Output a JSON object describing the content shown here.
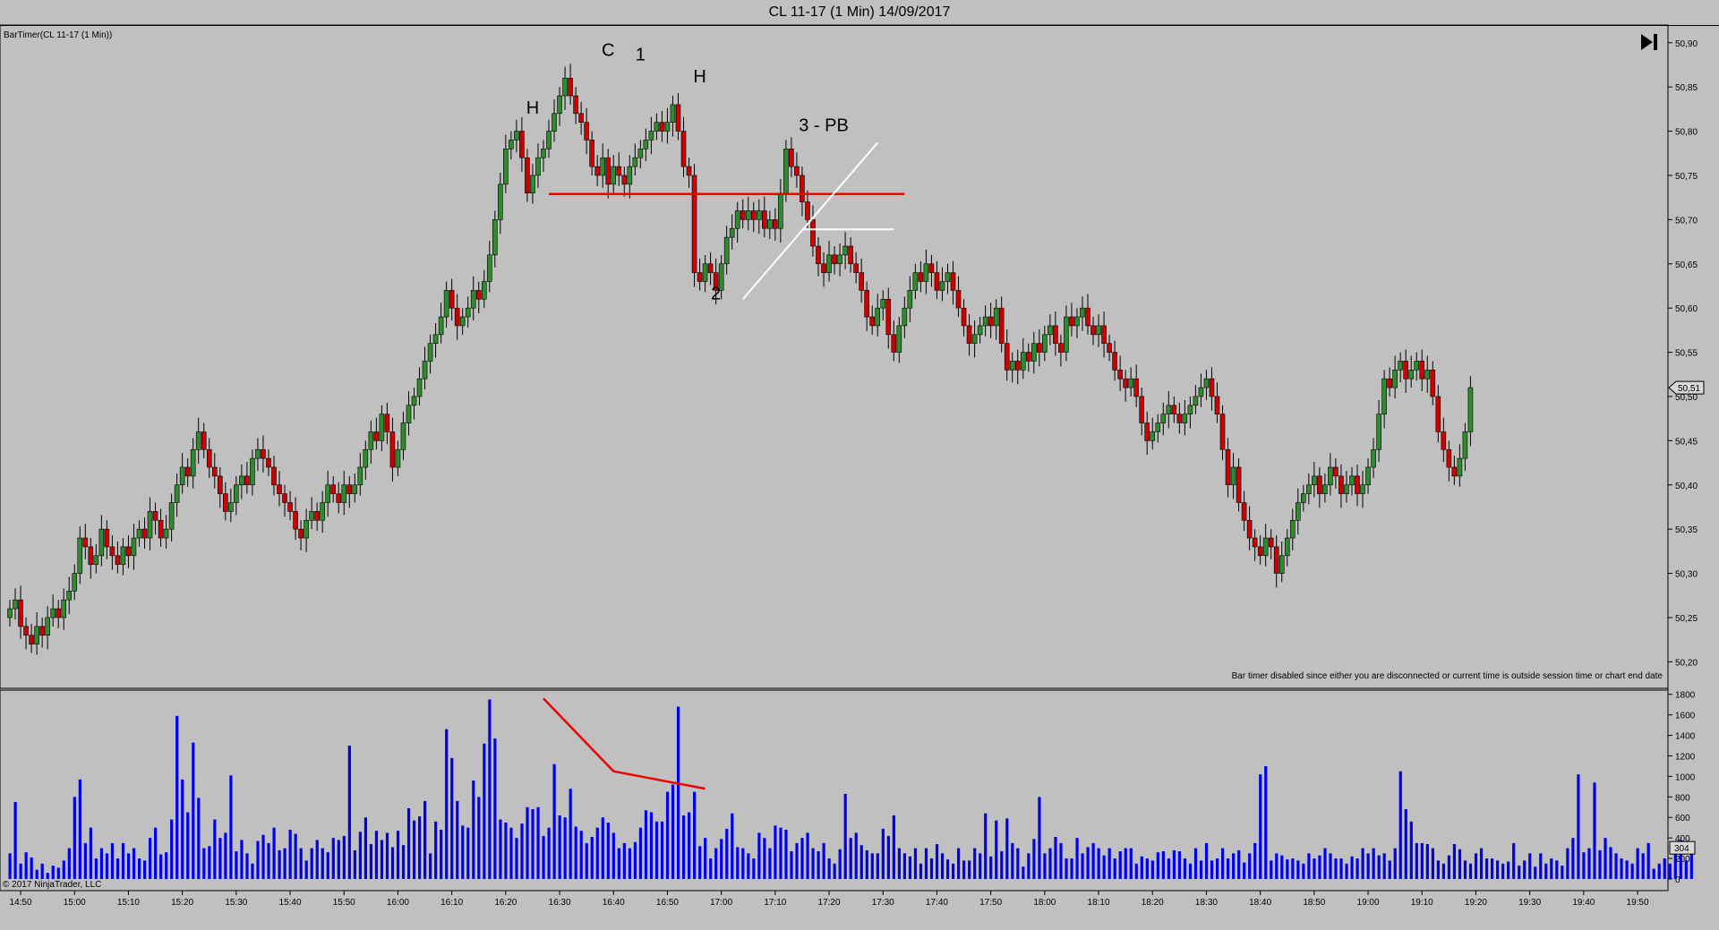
{
  "window": {
    "title": "CL 11-17 (1 Min)  14/09/2017"
  },
  "indicator_label": "BarTimer(CL 11-17 (1 Min))",
  "status_message": "Bar timer disabled since either you are disconnected or current time is outside session time or chart end date",
  "copyright": "© 2017 NinjaTrader, LLC",
  "colors": {
    "background": "#c0c0c0",
    "up_candle": "#2e8b2e",
    "down_candle": "#cc0000",
    "volume": "#0000ee",
    "red_annotation": "#ee0000",
    "white_line": "#ffffff"
  },
  "icons": {
    "go_to_end": "skip-to-end-icon"
  },
  "annotations": [
    {
      "text": "C",
      "time": "16:39",
      "price": 50.885
    },
    {
      "text": "1",
      "time": "16:45",
      "price": 50.88
    },
    {
      "text": "H",
      "time": "16:56",
      "price": 50.855
    },
    {
      "text": "H",
      "time": "16:25",
      "price": 50.82
    },
    {
      "text": "3 - PB",
      "time": "17:19",
      "price": 50.8
    },
    {
      "text": "2",
      "time": "16:59",
      "price": 50.61
    }
  ],
  "chart_data": [
    {
      "type": "candlestick",
      "instrument": "CL 11-17 (1 Min)",
      "date": "14/09/2017",
      "ylim": [
        50.17,
        50.92
      ],
      "y_ticks": [
        "50,90",
        "50,85",
        "50,80",
        "50,75",
        "50,70",
        "50,65",
        "50,60",
        "50,55",
        "50,50",
        "50,45",
        "50,40",
        "50,35",
        "50,30",
        "50,25",
        "50,20"
      ],
      "y_tick_values": [
        50.9,
        50.85,
        50.8,
        50.75,
        50.7,
        50.65,
        50.6,
        50.55,
        50.5,
        50.45,
        50.4,
        50.35,
        50.3,
        50.25,
        50.2
      ],
      "last_price_label": "50,51",
      "last_price": 50.51,
      "closes": [
        50.26,
        50.27,
        50.24,
        50.23,
        50.22,
        50.24,
        50.23,
        50.25,
        50.26,
        50.25,
        50.27,
        50.28,
        50.3,
        50.34,
        50.33,
        50.31,
        50.32,
        50.35,
        50.33,
        50.32,
        50.31,
        50.33,
        50.32,
        50.34,
        50.35,
        50.34,
        50.37,
        50.36,
        50.34,
        50.35,
        50.38,
        50.4,
        50.42,
        50.41,
        50.44,
        50.46,
        50.44,
        50.42,
        50.41,
        50.39,
        50.37,
        50.38,
        50.4,
        50.41,
        50.4,
        50.43,
        50.44,
        50.43,
        50.42,
        50.4,
        50.39,
        50.38,
        50.37,
        50.35,
        50.34,
        50.36,
        50.37,
        50.36,
        50.38,
        50.4,
        50.39,
        50.38,
        50.4,
        50.39,
        50.4,
        50.42,
        50.44,
        50.46,
        50.45,
        50.48,
        50.46,
        50.42,
        50.44,
        50.47,
        50.49,
        50.5,
        50.52,
        50.54,
        50.56,
        50.57,
        50.59,
        50.62,
        50.6,
        50.58,
        50.59,
        50.6,
        50.62,
        50.61,
        50.63,
        50.66,
        50.7,
        50.74,
        50.78,
        50.79,
        50.8,
        50.77,
        50.73,
        50.75,
        50.77,
        50.78,
        50.8,
        50.82,
        50.84,
        50.86,
        50.84,
        50.82,
        50.81,
        50.79,
        50.76,
        50.75,
        50.77,
        50.74,
        50.76,
        50.75,
        50.74,
        50.76,
        50.77,
        50.78,
        50.79,
        50.8,
        50.81,
        50.8,
        50.81,
        50.83,
        50.8,
        50.76,
        50.75,
        50.64,
        50.63,
        50.65,
        50.64,
        50.62,
        50.65,
        50.68,
        50.69,
        50.71,
        50.7,
        50.71,
        50.7,
        50.71,
        50.69,
        50.7,
        50.69,
        50.73,
        50.78,
        50.76,
        50.75,
        50.72,
        50.7,
        50.67,
        50.65,
        50.64,
        50.66,
        50.65,
        50.66,
        50.67,
        50.65,
        50.64,
        50.62,
        50.59,
        50.58,
        50.6,
        50.61,
        50.57,
        50.55,
        50.58,
        50.6,
        50.62,
        50.64,
        50.63,
        50.65,
        50.64,
        50.62,
        50.63,
        50.64,
        50.62,
        50.6,
        50.58,
        50.56,
        50.57,
        50.58,
        50.59,
        50.58,
        50.6,
        50.56,
        50.53,
        50.54,
        50.53,
        50.55,
        50.54,
        50.56,
        50.55,
        50.57,
        50.58,
        50.56,
        50.55,
        50.59,
        50.58,
        50.59,
        50.6,
        50.58,
        50.57,
        50.58,
        50.56,
        50.55,
        50.53,
        50.52,
        50.51,
        50.52,
        50.5,
        50.47,
        50.45,
        50.46,
        50.47,
        50.48,
        50.49,
        50.48,
        50.47,
        50.48,
        50.49,
        50.5,
        50.51,
        50.52,
        50.5,
        50.48,
        50.44,
        50.4,
        50.42,
        50.38,
        50.36,
        50.34,
        50.33,
        50.32,
        50.34,
        50.33,
        50.3,
        50.32,
        50.34,
        50.36,
        50.38,
        50.39,
        50.4,
        50.41,
        50.39,
        50.4,
        50.42,
        50.41,
        50.39,
        50.4,
        50.41,
        50.39,
        50.4,
        50.42,
        50.44,
        50.48,
        50.52,
        50.51,
        50.53,
        50.54,
        50.52,
        50.53,
        50.54,
        50.52,
        50.53,
        50.5,
        50.46,
        50.44,
        50.42,
        50.41,
        50.43,
        50.46,
        50.51
      ],
      "x_ticks": [
        "14:50",
        "15:00",
        "15:10",
        "15:20",
        "15:30",
        "15:40",
        "15:50",
        "16:00",
        "16:10",
        "16:20",
        "16:30",
        "16:40",
        "16:50",
        "17:00",
        "17:10",
        "17:20",
        "17:30",
        "17:40",
        "17:50",
        "18:00",
        "18:10",
        "18:20",
        "18:30",
        "18:40",
        "18:50",
        "19:00",
        "19:10",
        "19:20",
        "19:30",
        "19:40",
        "19:50"
      ]
    },
    {
      "type": "bar",
      "series": [
        {
          "name": "Volume",
          "values": [
            250,
            750,
            150,
            260,
            210,
            90,
            150,
            60,
            130,
            110,
            180,
            300,
            800,
            970,
            350,
            500,
            200,
            300,
            250,
            350,
            200,
            350,
            250,
            300,
            200,
            180,
            400,
            500,
            240,
            260,
            580,
            1590,
            970,
            650,
            1330,
            790,
            300,
            320,
            580,
            400,
            450,
            1010,
            270,
            380,
            250,
            150,
            370,
            430,
            350,
            500,
            280,
            300,
            480,
            440,
            300,
            180,
            300,
            380,
            300,
            260,
            400,
            380,
            420,
            1300,
            280,
            460,
            600,
            340,
            470,
            380,
            450,
            310,
            470,
            330,
            690,
            570,
            610,
            760,
            250,
            560,
            480,
            1460,
            1180,
            760,
            520,
            500,
            960,
            800,
            1320,
            1750,
            1370,
            580,
            550,
            500,
            400,
            540,
            700,
            680,
            700,
            420,
            500,
            1120,
            620,
            600,
            880,
            510,
            470,
            350,
            410,
            500,
            600,
            550,
            450,
            300,
            350,
            300,
            360,
            500,
            670,
            650,
            560,
            560,
            850,
            920,
            1680,
            620,
            650,
            850,
            320,
            400,
            200,
            300,
            390,
            490,
            640,
            310,
            300,
            250,
            200,
            450,
            400,
            300,
            520,
            500,
            480,
            270,
            350,
            400,
            450,
            300,
            270,
            350,
            200,
            150,
            290,
            830,
            400,
            450,
            330,
            280,
            250,
            250,
            490,
            420,
            620,
            300,
            250,
            220,
            300,
            150,
            300,
            200,
            340,
            250,
            190,
            150,
            300,
            180,
            180,
            300,
            250,
            640,
            220,
            570,
            270,
            590,
            350,
            300,
            120,
            250,
            390,
            800,
            250,
            300,
            410,
            350,
            200,
            200,
            400,
            250,
            310,
            350,
            300,
            230,
            300,
            200,
            270,
            300,
            300,
            150,
            220,
            200,
            180,
            260,
            270,
            200,
            280,
            270,
            200,
            150,
            300,
            180,
            350,
            180,
            200,
            300,
            200,
            250,
            280,
            160,
            250,
            350,
            1020,
            1100,
            180,
            250,
            230,
            190,
            200,
            180,
            150,
            250,
            200,
            230,
            300,
            250,
            200,
            200,
            150,
            220,
            200,
            300,
            250,
            300,
            230,
            250,
            180,
            300,
            1050,
            680,
            560,
            350,
            350,
            340,
            300,
            180,
            150,
            230,
            340,
            290,
            180,
            150,
            250,
            300,
            200,
            200,
            180,
            150,
            170,
            350,
            130,
            180,
            250,
            120,
            250,
            150,
            200,
            180,
            130,
            300,
            400,
            1020,
            260,
            300,
            940,
            280,
            400,
            310,
            250,
            200,
            180,
            150,
            300,
            250,
            350,
            100,
            150,
            200,
            150,
            350,
            380,
            180,
            310
          ]
        }
      ],
      "ylim": [
        0,
        1850
      ],
      "y_ticks": [
        "1800",
        "1600",
        "1400",
        "1200",
        "1000",
        "800",
        "600",
        "400",
        "200",
        "0"
      ],
      "y_tick_values": [
        1800,
        1600,
        1400,
        1200,
        1000,
        800,
        600,
        400,
        200,
        0
      ],
      "last_value_label": "304",
      "last_value": 304
    }
  ]
}
